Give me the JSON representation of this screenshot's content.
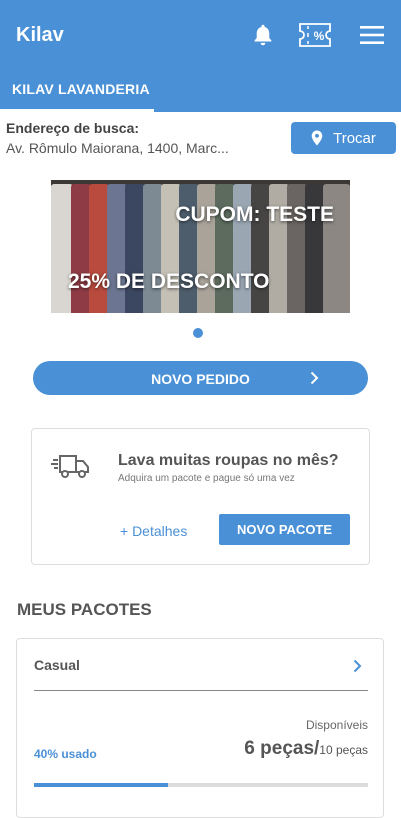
{
  "app": {
    "title": "Kilav"
  },
  "icons": {
    "bell": "bell-icon",
    "coupon": "coupon-percent-icon",
    "menu": "hamburger-menu-icon",
    "location": "location-pin-icon",
    "truck": "delivery-truck-icon",
    "chevron": "chevron-right-icon"
  },
  "tabs": [
    {
      "label": "KILAV LAVANDERIA",
      "active": true
    }
  ],
  "address": {
    "label": "Endereço de busca:",
    "value": "Av. Rômulo Maiorana, 1400, Marc...",
    "change_button": "Trocar"
  },
  "banner": {
    "coupon_text": "CUPOM: TESTE",
    "discount_text": "25% DE DESCONTO",
    "pages": 1,
    "active_page": 1
  },
  "new_order_button": "NOVO PEDIDO",
  "promo_card": {
    "title": "Lava muitas roupas no mês?",
    "subtitle": "Adquira um pacote e pague só uma vez",
    "details_link": "+ Detalhes",
    "new_package_button": "NOVO PACOTE"
  },
  "packages": {
    "section_title": "MEUS PACOTES",
    "items": [
      {
        "name": "Casual",
        "available_label": "Disponíveis",
        "used_label": "40% usado",
        "used_fraction": 0.4,
        "pieces_text": "6 peças/",
        "total_text": "10 peças"
      }
    ]
  },
  "colors": {
    "primary": "#4a90d6",
    "text": "#555555",
    "divider": "#dddddd"
  }
}
